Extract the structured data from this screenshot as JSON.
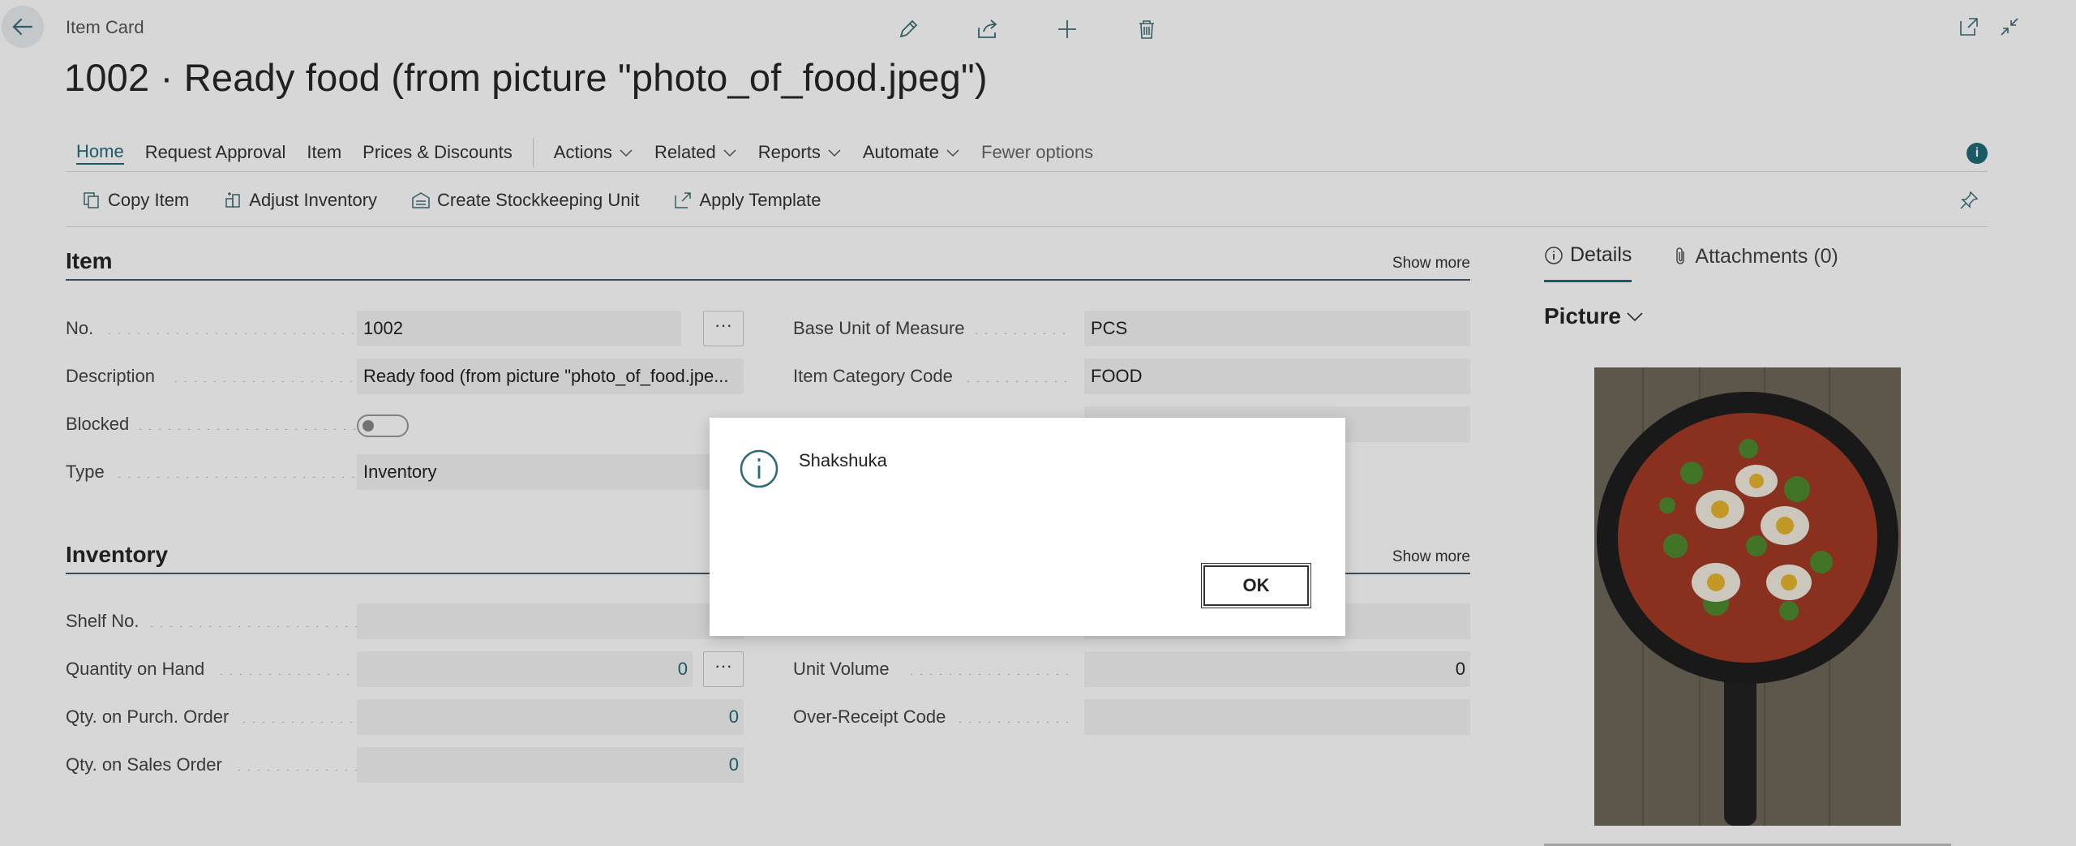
{
  "header": {
    "breadcrumb": "Item Card",
    "title": "1002 · Ready food (from picture \"photo_of_food.jpeg\")",
    "icons": [
      "back-arrow-icon",
      "edit-pencil-icon",
      "share-icon",
      "add-plus-icon",
      "delete-trash-icon",
      "open-new-window-icon",
      "collapse-icon"
    ]
  },
  "nav": {
    "items": [
      {
        "label": "Home"
      },
      {
        "label": "Request Approval"
      },
      {
        "label": "Item"
      },
      {
        "label": "Prices & Discounts"
      },
      {
        "label": "Actions"
      },
      {
        "label": "Related"
      },
      {
        "label": "Reports"
      },
      {
        "label": "Automate"
      },
      {
        "label": "Fewer options"
      }
    ],
    "info_icon": "i"
  },
  "actions": {
    "items": [
      {
        "label": "Copy Item"
      },
      {
        "label": "Adjust Inventory"
      },
      {
        "label": "Create Stockkeeping Unit"
      },
      {
        "label": "Apply Template"
      }
    ]
  },
  "item_section": {
    "title": "Item",
    "show_more": "Show more",
    "no_label": "No.",
    "no_value": "1002",
    "description_label": "Description",
    "description_value": "Ready food (from picture \"photo_of_food.jpe...",
    "blocked_label": "Blocked",
    "blocked_value": false,
    "type_label": "Type",
    "type_value": "Inventory",
    "base_uom_label": "Base Unit of Measure",
    "base_uom_value": "PCS",
    "category_label": "Item Category Code",
    "category_value": "FOOD"
  },
  "inventory_section": {
    "title": "Inventory",
    "show_more": "Show more",
    "shelf_label": "Shelf No.",
    "shelf_value": "",
    "qoh_label": "Quantity on Hand",
    "qoh_value": "0",
    "qpo_label": "Qty. on Purch. Order",
    "qpo_value": "0",
    "qso_label": "Qty. on Sales Order",
    "qso_value": "0",
    "unit_volume_label": "Unit Volume",
    "unit_volume_value": "0",
    "over_receipt_label": "Over-Receipt Code",
    "over_receipt_value": ""
  },
  "factbox": {
    "details_tab": "Details",
    "attachments_tab": "Attachments (0)",
    "picture_title": "Picture"
  },
  "dialog": {
    "message": "Shakshuka",
    "ok_label": "OK"
  },
  "colors": {
    "accent": "#1f6b78",
    "overlay": "rgba(0,0,0,0.155)"
  }
}
